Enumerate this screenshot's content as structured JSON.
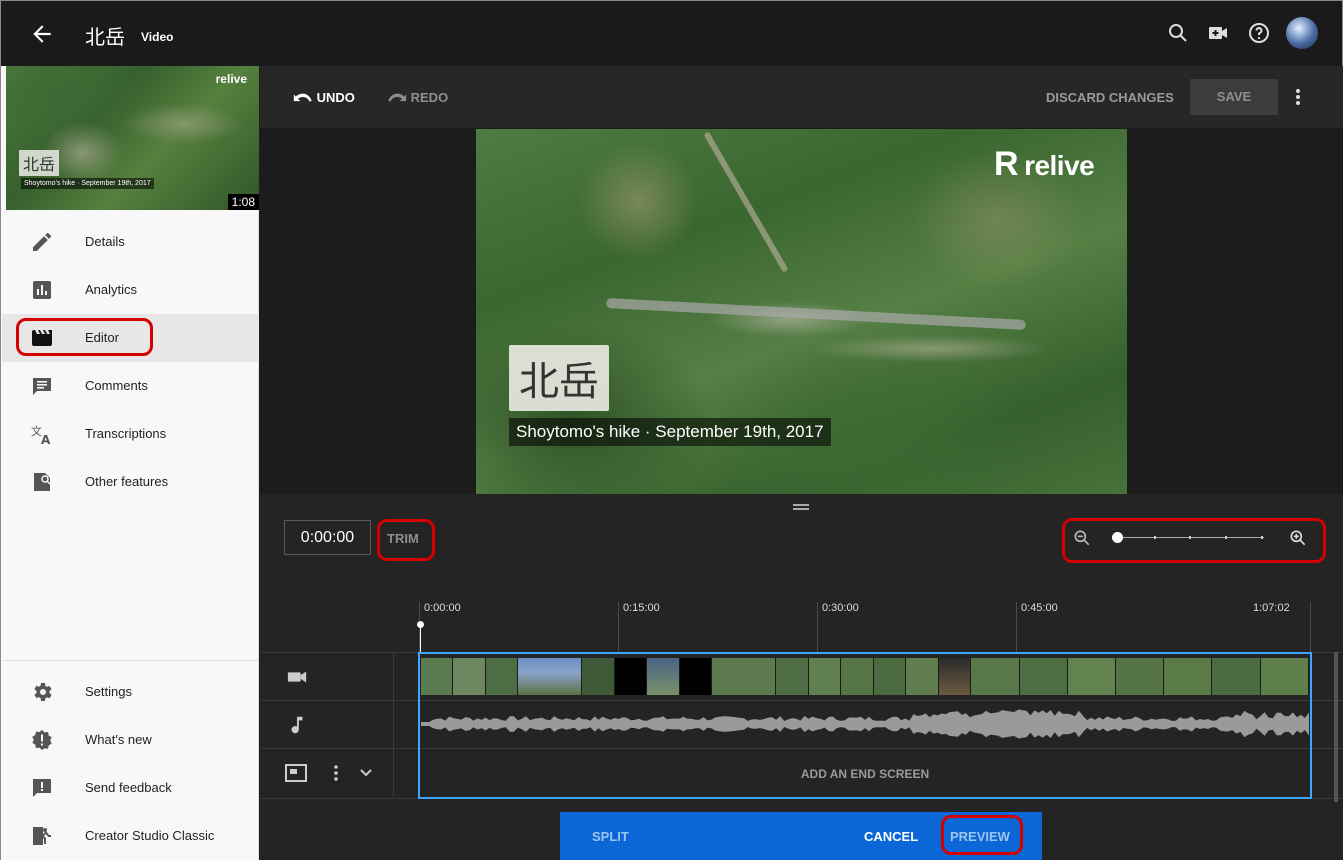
{
  "header": {
    "title": "北岳",
    "subtitle": "Video",
    "icons": [
      "back-arrow-icon",
      "search-icon",
      "create-video-icon",
      "help-icon",
      "avatar"
    ]
  },
  "thumbnail": {
    "logo": "relive",
    "title": "北岳",
    "caption": "Shoytomo's hike · September 19th, 2017",
    "duration": "1:08"
  },
  "sidebar": {
    "items": [
      {
        "label": "Details",
        "icon": "pencil-icon"
      },
      {
        "label": "Analytics",
        "icon": "bar-chart-icon"
      },
      {
        "label": "Editor",
        "icon": "clapperboard-icon"
      },
      {
        "label": "Comments",
        "icon": "comment-icon"
      },
      {
        "label": "Transcriptions",
        "icon": "translate-icon"
      },
      {
        "label": "Other features",
        "icon": "other-features-icon"
      }
    ],
    "bottom_items": [
      {
        "label": "Settings",
        "icon": "gear-icon"
      },
      {
        "label": "What's new",
        "icon": "alert-badge-icon"
      },
      {
        "label": "Send feedback",
        "icon": "feedback-icon"
      },
      {
        "label": "Creator Studio Classic",
        "icon": "exit-icon"
      }
    ]
  },
  "toolbar": {
    "undo": "UNDO",
    "redo": "REDO",
    "discard": "DISCARD CHANGES",
    "save": "SAVE"
  },
  "video": {
    "logo": "relive",
    "title": "北岳",
    "caption": "Shoytomo's hike · September 19th, 2017"
  },
  "timeline": {
    "timecode": "0:00:00",
    "trim": "TRIM",
    "ruler": [
      "0:00:00",
      "0:15:00",
      "0:30:00",
      "0:45:00",
      "1:07:02"
    ],
    "end_screen": "ADD AN END SCREEN"
  },
  "actions": {
    "split": "SPLIT",
    "cancel": "CANCEL",
    "preview": "PREVIEW"
  },
  "colors": {
    "accent_blue": "#3ea6ff",
    "action_bar": "#0a67d5",
    "highlight_red": "#d50000"
  }
}
